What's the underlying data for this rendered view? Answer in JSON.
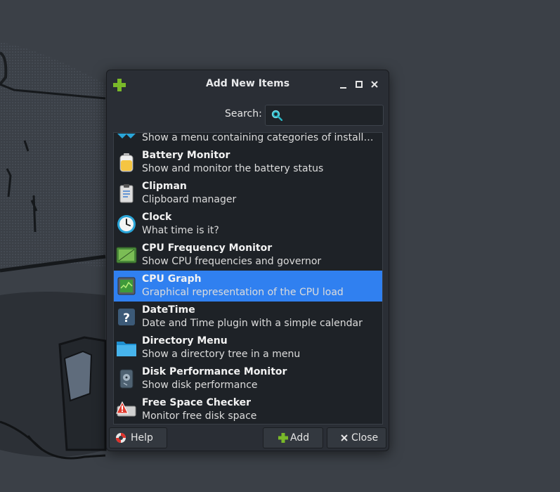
{
  "dialog": {
    "title": "Add New Items",
    "window_buttons": [
      "minimize",
      "maximize",
      "close"
    ]
  },
  "search": {
    "label": "Search:",
    "value": ""
  },
  "items": [
    {
      "name": "",
      "desc": "Show a menu containing categories of installed ap...",
      "icon": "applications-menu-icon"
    },
    {
      "name": "Battery Monitor",
      "desc": "Show and monitor the battery status",
      "icon": "battery-icon"
    },
    {
      "name": "Clipman",
      "desc": "Clipboard manager",
      "icon": "clipboard-icon"
    },
    {
      "name": "Clock",
      "desc": "What time is it?",
      "icon": "clock-icon"
    },
    {
      "name": "CPU Frequency Monitor",
      "desc": "Show CPU frequencies and governor",
      "icon": "cpu-frequency-icon"
    },
    {
      "name": "CPU Graph",
      "desc": "Graphical representation of the CPU load",
      "icon": "cpu-graph-icon",
      "selected": true
    },
    {
      "name": "DateTime",
      "desc": "Date and Time plugin with a simple calendar",
      "icon": "datetime-icon"
    },
    {
      "name": "Directory Menu",
      "desc": "Show a directory tree in a menu",
      "icon": "folder-icon"
    },
    {
      "name": "Disk Performance Monitor",
      "desc": "Show disk performance",
      "icon": "disk-icon"
    },
    {
      "name": "Free Space Checker",
      "desc": "Monitor free disk space",
      "icon": "free-space-warning-icon"
    }
  ],
  "buttons": {
    "help": "Help",
    "add": "Add",
    "close": "Close"
  },
  "colors": {
    "selection": "#3080f0",
    "dialog_bg": "#2a2e35",
    "add_accent": "#7ab929"
  }
}
